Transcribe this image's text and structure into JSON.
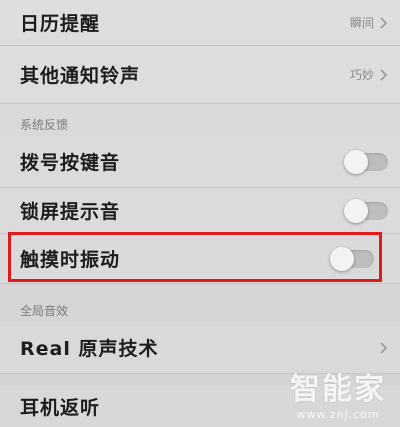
{
  "rows": {
    "calendar_reminder": {
      "label": "日历提醒",
      "value": "瞬间"
    },
    "other_ringtone": {
      "label": "其他通知铃声",
      "value": "巧妙"
    },
    "dial_keypad": {
      "label": "拨号按键音"
    },
    "lock_screen": {
      "label": "锁屏提示音"
    },
    "touch_vibrate": {
      "label": "触摸时振动"
    },
    "real_sound": {
      "label": "Real 原声技术"
    },
    "earphone_monitor": {
      "label": "耳机返听"
    }
  },
  "sections": {
    "system_feedback": "系统反馈",
    "global_sound": "全局音效"
  },
  "toggles": {
    "dial_keypad": false,
    "lock_screen": false,
    "touch_vibrate": false
  },
  "watermark": {
    "main": "智能家",
    "url": "www.znj.com"
  },
  "colors": {
    "highlight": "#e01a1a"
  }
}
